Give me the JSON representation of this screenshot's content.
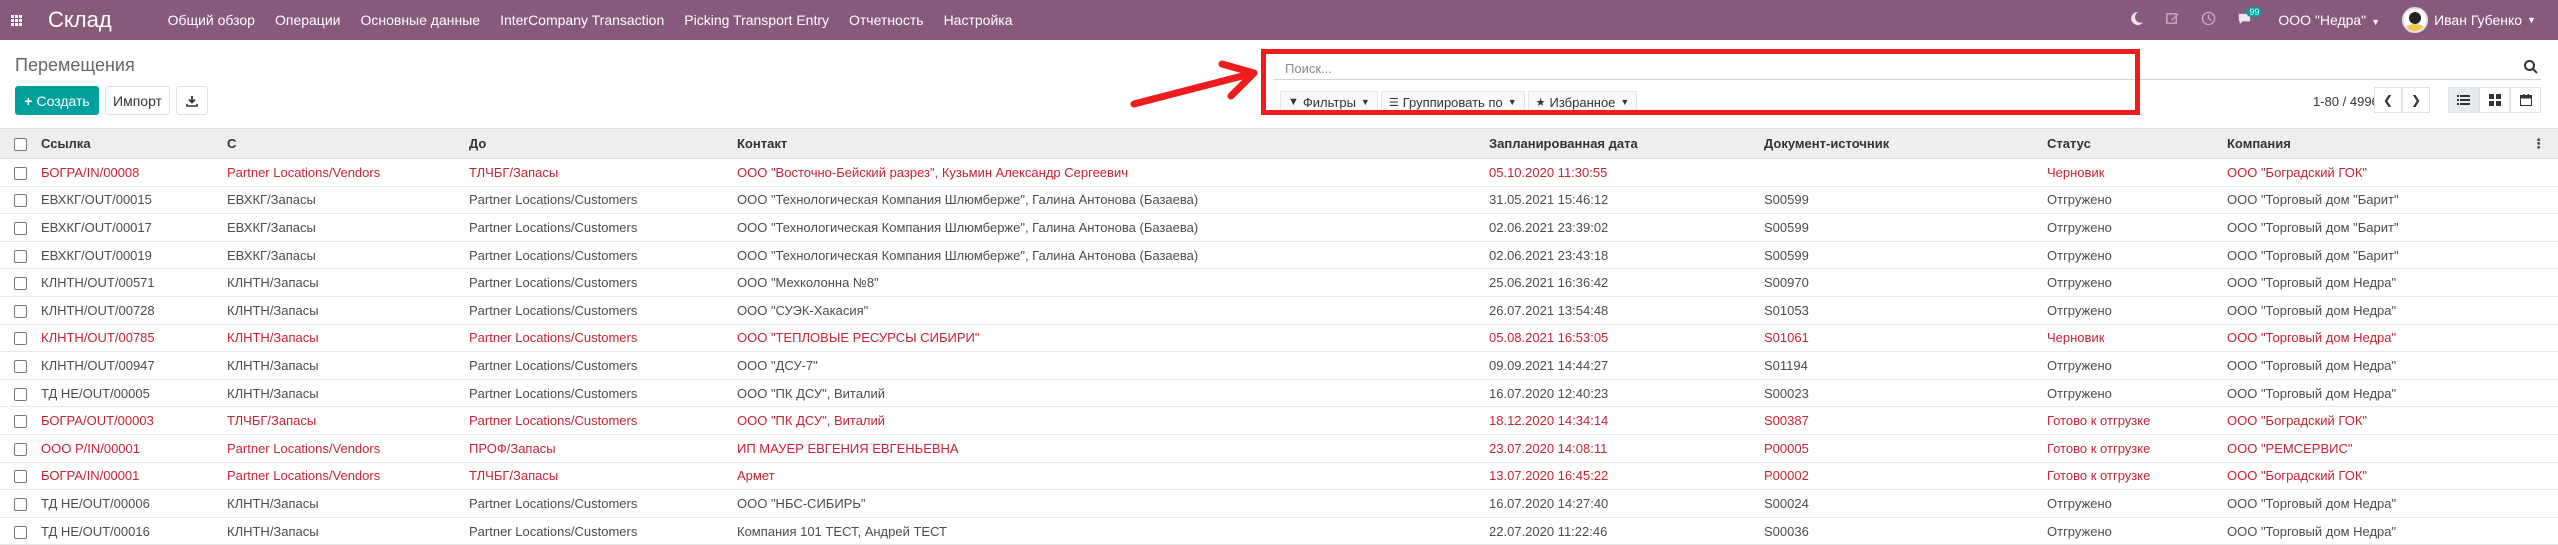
{
  "app": {
    "brand": "Склад",
    "menu": [
      "Общий обзор",
      "Операции",
      "Основные данные",
      "InterCompany Transaction",
      "Picking Transport Entry",
      "Отчетность",
      "Настройка"
    ],
    "chat_count": "99",
    "company": "ООО \"Недра\"",
    "user": "Иван Губенко"
  },
  "control": {
    "breadcrumb": "Перемещения",
    "create_label": "Создать",
    "import_label": "Импорт",
    "search_placeholder": "Поиск...",
    "filters_label": "Фильтры",
    "groupby_label": "Группировать по",
    "favorites_label": "Избранное",
    "pager": "1-80 / 4996"
  },
  "colors": {
    "navbar": "#875a7b",
    "primary": "#00a09d",
    "highlight": "#ee1c1c",
    "late_text": "#c82333"
  },
  "table": {
    "headers": [
      "Ссылка",
      "С",
      "До",
      "Контакт",
      "Запланированная дата",
      "Документ-источник",
      "Статус",
      "Компания"
    ],
    "rows": [
      {
        "style": "red",
        "cells": [
          "БОГРА/IN/00008",
          "Partner Locations/Vendors",
          "ТЛЧБГ/Запасы",
          "ООО \"Восточно-Бейский разрез\", Кузьмин Александр Сергеевич",
          "05.10.2020 11:30:55",
          "",
          "Черновик",
          "ООО \"Боградский ГОК\""
        ]
      },
      {
        "style": "normal",
        "cells": [
          "ЕВХКГ/OUT/00015",
          "ЕВХКГ/Запасы",
          "Partner Locations/Customers",
          "ООО \"Технологическая Компания Шлюмберже\", Галина Антонова (Базаева)",
          "31.05.2021 15:46:12",
          "S00599",
          "Отгружено",
          "ООО \"Торговый дом \"Барит\""
        ]
      },
      {
        "style": "normal",
        "cells": [
          "ЕВХКГ/OUT/00017",
          "ЕВХКГ/Запасы",
          "Partner Locations/Customers",
          "ООО \"Технологическая Компания Шлюмберже\", Галина Антонова (Базаева)",
          "02.06.2021 23:39:02",
          "S00599",
          "Отгружено",
          "ООО \"Торговый дом \"Барит\""
        ]
      },
      {
        "style": "normal",
        "cells": [
          "ЕВХКГ/OUT/00019",
          "ЕВХКГ/Запасы",
          "Partner Locations/Customers",
          "ООО \"Технологическая Компания Шлюмберже\", Галина Антонова (Базаева)",
          "02.06.2021 23:43:18",
          "S00599",
          "Отгружено",
          "ООО \"Торговый дом \"Барит\""
        ]
      },
      {
        "style": "normal",
        "cells": [
          "КЛНТН/OUT/00571",
          "КЛНТН/Запасы",
          "Partner Locations/Customers",
          "ООО \"Мехколонна №8\"",
          "25.06.2021 16:36:42",
          "S00970",
          "Отгружено",
          "ООО \"Торговый дом Недра\""
        ]
      },
      {
        "style": "normal",
        "cells": [
          "КЛНТН/OUT/00728",
          "КЛНТН/Запасы",
          "Partner Locations/Customers",
          "ООО \"СУЭК-Хакасия\"",
          "26.07.2021 13:54:48",
          "S01053",
          "Отгружено",
          "ООО \"Торговый дом Недра\""
        ]
      },
      {
        "style": "red",
        "cells": [
          "КЛНТН/OUT/00785",
          "КЛНТН/Запасы",
          "Partner Locations/Customers",
          "ООО \"ТЕПЛОВЫЕ РЕСУРСЫ СИБИРИ\"",
          "05.08.2021 16:53:05",
          "S01061",
          "Черновик",
          "ООО \"Торговый дом Недра\""
        ]
      },
      {
        "style": "normal",
        "cells": [
          "КЛНТН/OUT/00947",
          "КЛНТН/Запасы",
          "Partner Locations/Customers",
          "ООО \"ДСУ-7\"",
          "09.09.2021 14:44:27",
          "S01194",
          "Отгружено",
          "ООО \"Торговый дом Недра\""
        ]
      },
      {
        "style": "normal",
        "cells": [
          "ТД НЕ/OUT/00005",
          "КЛНТН/Запасы",
          "Partner Locations/Customers",
          "ООО \"ПК ДСУ\", Виталий",
          "16.07.2020 12:40:23",
          "S00023",
          "Отгружено",
          "ООО \"Торговый дом Недра\""
        ]
      },
      {
        "style": "red",
        "cells": [
          "БОГРА/OUT/00003",
          "ТЛЧБГ/Запасы",
          "Partner Locations/Customers",
          "ООО \"ПК ДСУ\", Виталий",
          "18.12.2020 14:34:14",
          "S00387",
          "Готово к отгрузке",
          "ООО \"Боградский ГОК\""
        ]
      },
      {
        "style": "red",
        "cells": [
          "ООО Р/IN/00001",
          "Partner Locations/Vendors",
          "ПРОФ/Запасы",
          "ИП МАУЕР ЕВГЕНИЯ ЕВГЕНЬЕВНА",
          "23.07.2020 14:08:11",
          "P00005",
          "Готово к отгрузке",
          "ООО \"РЕМСЕРВИС\""
        ]
      },
      {
        "style": "red",
        "cells": [
          "БОГРА/IN/00001",
          "Partner Locations/Vendors",
          "ТЛЧБГ/Запасы",
          "Армет",
          "13.07.2020 16:45:22",
          "P00002",
          "Готово к отгрузке",
          "ООО \"Боградский ГОК\""
        ]
      },
      {
        "style": "normal",
        "cells": [
          "ТД НЕ/OUT/00006",
          "КЛНТН/Запасы",
          "Partner Locations/Customers",
          "ООО \"НБС-СИБИРЬ\"",
          "16.07.2020 14:27:40",
          "S00024",
          "Отгружено",
          "ООО \"Торговый дом Недра\""
        ]
      },
      {
        "style": "normal",
        "cells": [
          "ТД НЕ/OUT/00016",
          "КЛНТН/Запасы",
          "Partner Locations/Customers",
          "Компания 101 ТЕСТ, Андрей ТЕСТ",
          "22.07.2020 11:22:46",
          "S00036",
          "Отгружено",
          "ООО \"Торговый дом Недра\""
        ]
      }
    ]
  }
}
